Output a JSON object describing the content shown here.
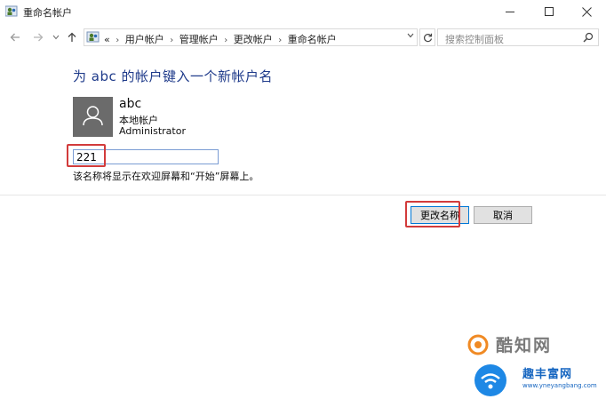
{
  "window": {
    "title": "重命名帐户",
    "icons": {
      "app": "user-accounts-icon",
      "minimize": "minimize-icon",
      "maximize": "maximize-icon",
      "close": "close-icon"
    }
  },
  "nav": {
    "breadcrumb_lead": "«",
    "breadcrumbs": [
      "用户帐户",
      "管理帐户",
      "更改帐户",
      "重命名帐户"
    ],
    "search_placeholder": "搜索控制面板"
  },
  "content": {
    "heading": "为 abc 的帐户键入一个新帐户名",
    "account": {
      "name": "abc",
      "type": "本地帐户",
      "role": "Administrator"
    },
    "new_name_value": "221",
    "hint": "该名称将显示在欢迎屏幕和“开始”屏幕上。"
  },
  "buttons": {
    "rename": "更改名称",
    "cancel": "取消"
  },
  "watermark": {
    "brand1": "酷知网",
    "brand2": "趣丰富网",
    "url": "www.yneyangbang.com"
  },
  "colors": {
    "heading": "#1e3a8a",
    "highlight": "#d23b3b",
    "avatar_bg": "#6b6b6b"
  }
}
